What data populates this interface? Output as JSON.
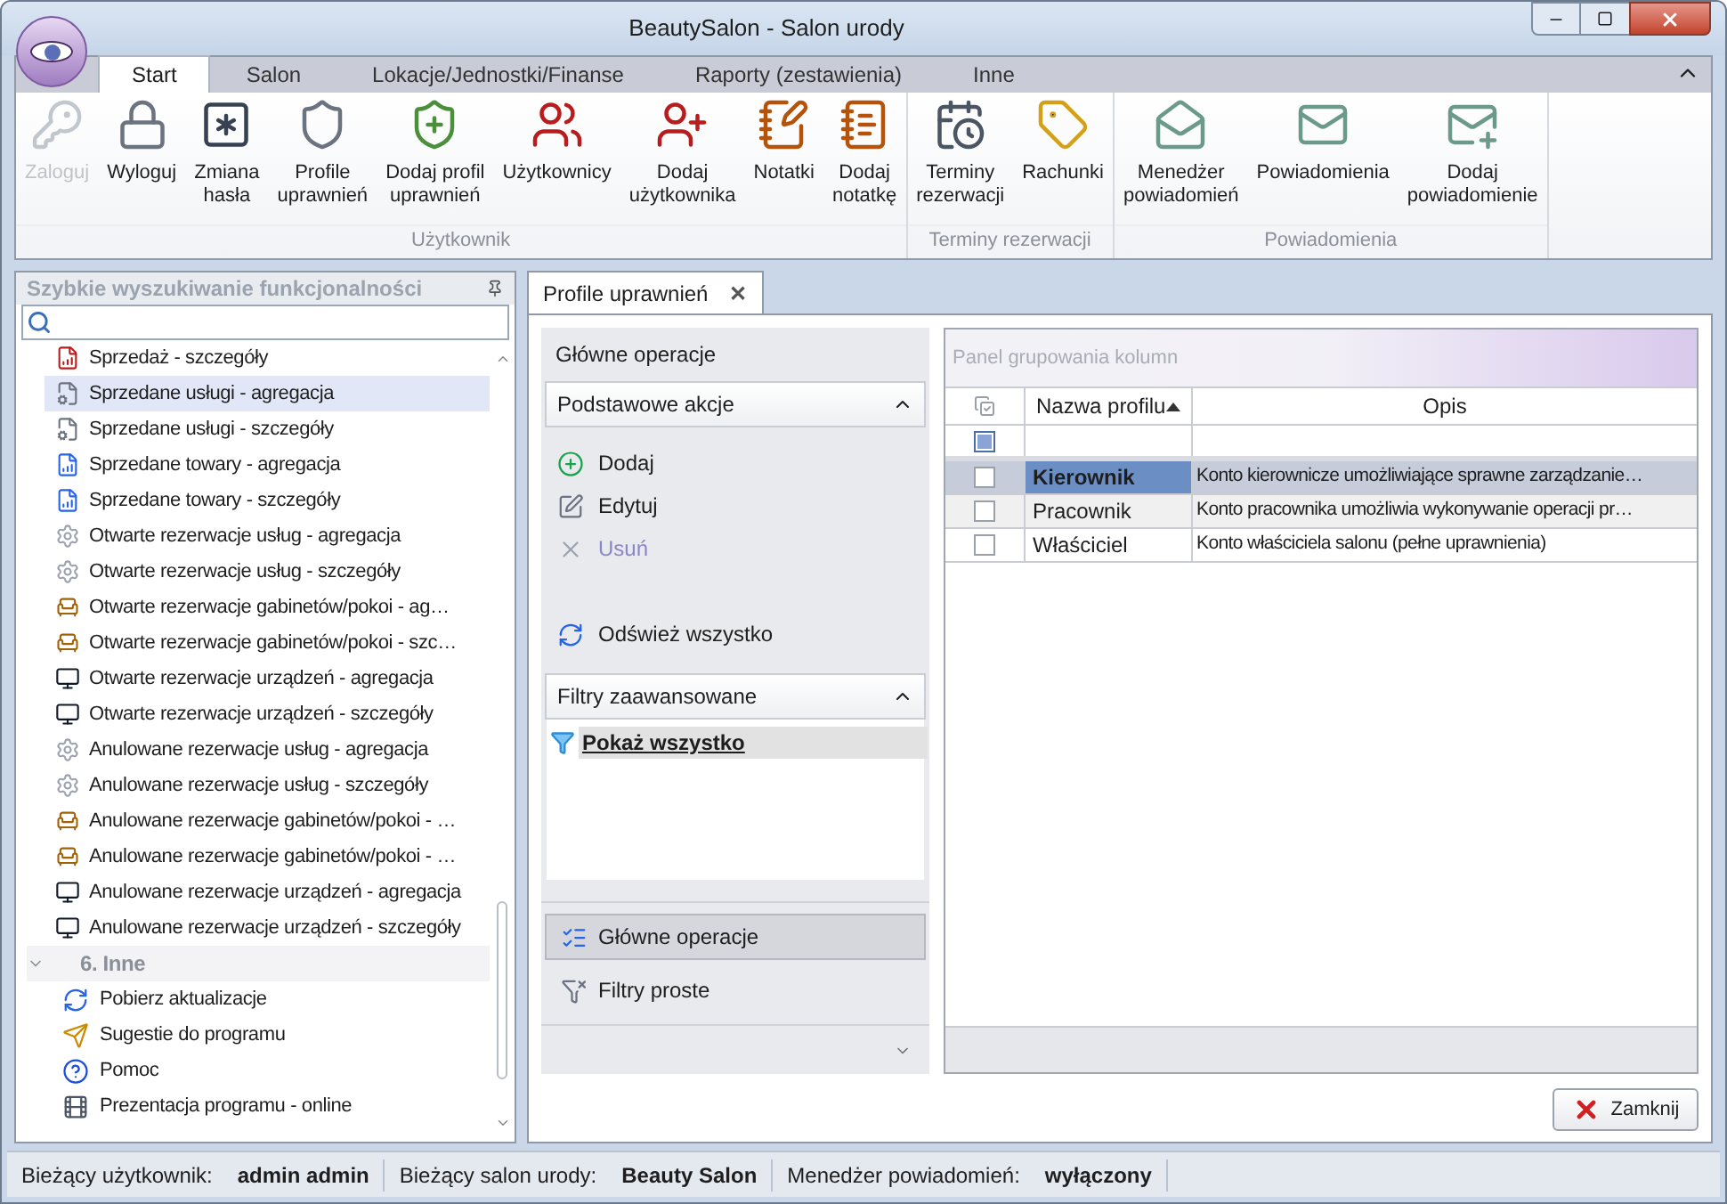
{
  "window": {
    "title": "BeautySalon - Salon urody"
  },
  "ribbon_tabs": [
    {
      "label": "Start",
      "selected": true
    },
    {
      "label": "Salon",
      "selected": false
    },
    {
      "label": "Lokacje/Jednostki/Finanse",
      "selected": false
    },
    {
      "label": "Raporty (zestawienia)",
      "selected": false
    },
    {
      "label": "Inne",
      "selected": false
    }
  ],
  "ribbon_groups": [
    {
      "label": "Użytkownik",
      "buttons": [
        {
          "label": "Zaloguj",
          "disabled": true
        },
        {
          "label": "Wyloguj",
          "disabled": false
        },
        {
          "label": "Zmiana\nhasła",
          "disabled": false
        },
        {
          "label": "Profile\nuprawnień",
          "disabled": false
        },
        {
          "label": "Dodaj profil\nuprawnień",
          "disabled": false
        },
        {
          "label": "Użytkownicy",
          "disabled": false
        },
        {
          "label": "Dodaj\nużytkownika",
          "disabled": false
        },
        {
          "label": "Notatki",
          "disabled": false
        },
        {
          "label": "Dodaj\nnotatkę",
          "disabled": false
        }
      ]
    },
    {
      "label": "Terminy rezerwacji",
      "buttons": [
        {
          "label": "Terminy\nrezerwacji",
          "disabled": false
        },
        {
          "label": "Rachunki",
          "disabled": false
        }
      ]
    },
    {
      "label": "Powiadomienia",
      "buttons": [
        {
          "label": "Menedżer\npowiadomień",
          "disabled": false
        },
        {
          "label": "Powiadomienia",
          "disabled": false
        },
        {
          "label": "Dodaj\npowiadomienie",
          "disabled": false
        }
      ]
    }
  ],
  "search_panel": {
    "title": "Szybkie wyszukiwanie funkcjonalności",
    "items": [
      {
        "label": "Sprzedaż - szczegóły",
        "selected": false
      },
      {
        "label": "Sprzedane usługi - agregacja",
        "selected": true
      },
      {
        "label": "Sprzedane usługi - szczegóły",
        "selected": false
      },
      {
        "label": "Sprzedane towary - agregacja",
        "selected": false
      },
      {
        "label": "Sprzedane towary - szczegóły",
        "selected": false
      },
      {
        "label": "Otwarte rezerwacje usług - agregacja",
        "selected": false
      },
      {
        "label": "Otwarte rezerwacje usług - szczegóły",
        "selected": false
      },
      {
        "label": "Otwarte rezerwacje gabinetów/pokoi - ag…",
        "selected": false
      },
      {
        "label": "Otwarte rezerwacje gabinetów/pokoi - szc…",
        "selected": false
      },
      {
        "label": "Otwarte rezerwacje urządzeń - agregacja",
        "selected": false
      },
      {
        "label": "Otwarte rezerwacje urządzeń - szczegóły",
        "selected": false
      },
      {
        "label": "Anulowane rezerwacje usług - agregacja",
        "selected": false
      },
      {
        "label": "Anulowane rezerwacje usług - szczegóły",
        "selected": false
      },
      {
        "label": "Anulowane rezerwacje gabinetów/pokoi - …",
        "selected": false
      },
      {
        "label": "Anulowane rezerwacje gabinetów/pokoi - …",
        "selected": false
      },
      {
        "label": "Anulowane rezerwacje urządzeń - agregacja",
        "selected": false
      },
      {
        "label": "Anulowane rezerwacje urządzeń - szczegóły",
        "selected": false
      }
    ],
    "group": {
      "label": "6. Inne",
      "expanded": true,
      "children": [
        {
          "label": "Pobierz aktualizacje",
          "selected": false
        },
        {
          "label": "Sugestie do programu",
          "selected": false
        },
        {
          "label": "Pomoc",
          "selected": false
        },
        {
          "label": "Prezentacja programu - online",
          "selected": false
        }
      ]
    }
  },
  "document_tab": {
    "label": "Profile uprawnień",
    "close": "✕"
  },
  "operations": {
    "title": "Główne operacje",
    "sections": [
      {
        "label": "Podstawowe akcje",
        "expanded": true,
        "actions": [
          {
            "label": "Dodaj",
            "disabled": false
          },
          {
            "label": "Edytuj",
            "disabled": false
          },
          {
            "label": "Usuń",
            "disabled": true
          },
          {
            "label": "Odśwież wszystko",
            "disabled": false
          }
        ]
      },
      {
        "label": "Filtry zaawansowane",
        "expanded": true,
        "filters": [
          {
            "label": "Pokaż wszystko",
            "selected": true
          }
        ]
      }
    ],
    "nav": [
      {
        "label": "Główne operacje",
        "selected": true
      },
      {
        "label": "Filtry proste",
        "selected": false
      }
    ]
  },
  "grid": {
    "group_panel": {
      "placeholder": "Panel grupowania kolumn"
    },
    "columns": [
      {
        "label": "Nazwa profilu",
        "sorted_ascending": true
      },
      {
        "label": "Opis"
      }
    ],
    "filter_row": {
      "checked": false
    },
    "rows": [
      {
        "name": "Kierownik",
        "description": "Konto kierownicze umożliwiające sprawne zarządzanie…",
        "selected": true,
        "checked": false
      },
      {
        "name": "Pracownik",
        "description": "Konto pracownika umożliwia wykonywanie operacji pr…",
        "selected": false,
        "checked": false
      },
      {
        "name": "Właściciel",
        "description": "Konto właściciela salonu (pełne uprawnienia)",
        "selected": false,
        "checked": false
      }
    ]
  },
  "close_button": {
    "label": "Zamknij"
  },
  "status_bar": [
    {
      "label": "Bieżący użytkownik:",
      "value": "admin admin"
    },
    {
      "label": "Bieżący salon urody:",
      "value": "Beauty Salon"
    },
    {
      "label": "Menedżer powiadomień:",
      "value": "wyłączony"
    }
  ]
}
